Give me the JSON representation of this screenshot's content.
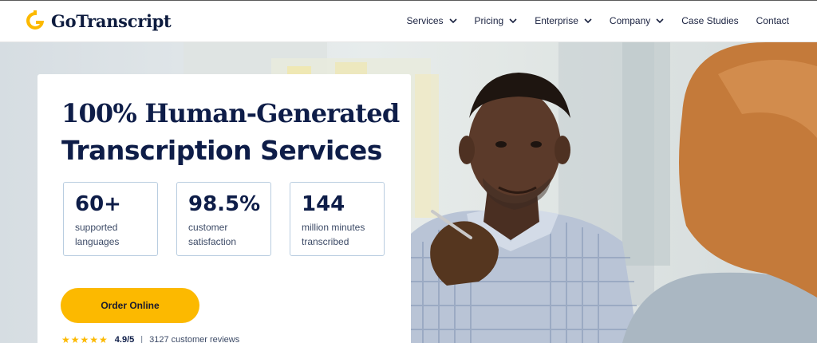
{
  "brand": {
    "name": "GoTranscript",
    "accent_color": "#fcb900",
    "navy_color": "#0e1d48"
  },
  "nav": {
    "items": [
      {
        "label": "Services",
        "has_dropdown": true
      },
      {
        "label": "Pricing",
        "has_dropdown": true
      },
      {
        "label": "Enterprise",
        "has_dropdown": true
      },
      {
        "label": "Company",
        "has_dropdown": true
      },
      {
        "label": "Case Studies",
        "has_dropdown": false
      },
      {
        "label": "Contact",
        "has_dropdown": false
      }
    ]
  },
  "hero": {
    "headline_line1": "100% Human-Generated",
    "headline_line2": "Transcription Services",
    "stats": [
      {
        "value": "60+",
        "label": "supported languages"
      },
      {
        "value": "98.5%",
        "label": "customer satisfaction"
      },
      {
        "value": "144",
        "label": "million minutes transcribed"
      }
    ],
    "cta_label": "Order Online",
    "rating": {
      "stars": 4.5,
      "score": "4.9/5",
      "separator": "|",
      "reviews": "3127 customer reviews"
    }
  }
}
